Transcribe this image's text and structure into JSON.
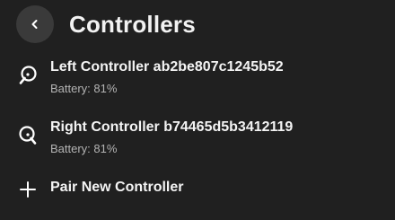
{
  "header": {
    "back_icon": "chevron-left-icon",
    "title": "Controllers"
  },
  "controllers": [
    {
      "icon": "controller-icon",
      "name": "Left Controller ab2be807c1245b52",
      "battery": "Battery: 81%"
    },
    {
      "icon": "controller-icon",
      "name": "Right Controller b74465d5b3412119",
      "battery": "Battery: 81%"
    }
  ],
  "pair": {
    "icon": "plus-icon",
    "label": "Pair New Controller"
  },
  "colors": {
    "background": "#202020",
    "button_bg": "#3a3a3a",
    "text_primary": "#f4f4f4",
    "text_secondary": "#b4b4b4"
  }
}
